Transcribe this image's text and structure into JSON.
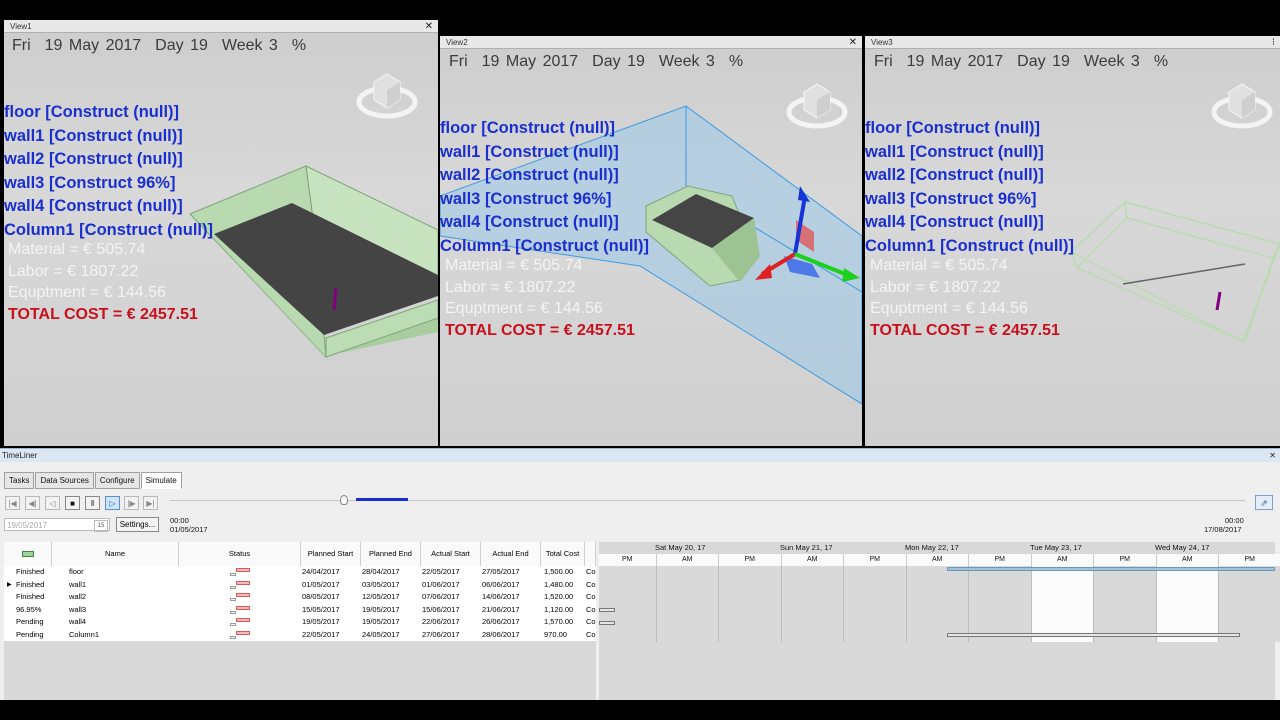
{
  "views": [
    {
      "title": "View1",
      "header": {
        "day_name": "Fri",
        "date": "19 May 2017",
        "day": "Day 19",
        "week": "Week 3",
        "pct": "%"
      }
    },
    {
      "title": "View2",
      "header": {
        "day_name": "Fri",
        "date": "19 May 2017",
        "day": "Day 19",
        "week": "Week 3",
        "pct": "%"
      }
    },
    {
      "title": "View3",
      "header": {
        "day_name": "Fri",
        "date": "19 May 2017",
        "day": "Day 19",
        "week": "Week 3",
        "pct": "%"
      }
    }
  ],
  "elements": [
    "floor [Construct (null)]",
    "wall1 [Construct (null)]",
    "wall2 [Construct (null)]",
    "wall3 [Construct 96%]",
    "wall4 [Construct (null)]",
    "Column1 [Construct (null)]"
  ],
  "costs": {
    "material": "Material  = € 505.74",
    "labor": "Labor = € 1807.22",
    "equipment": "Equptment = € 144.56",
    "total": "TOTAL COST = €  2457.51"
  },
  "colors": {
    "element_text": "#1a2fcf",
    "total_text": "#c8101c",
    "cost_text": "#f4f4f4",
    "wall_green": "#b9d9b0",
    "floor_dark": "#444444",
    "selection_blue": "#8ec6ee"
  },
  "timeliner": {
    "title": "TimeLiner",
    "tabs": [
      "Tasks",
      "Data Sources",
      "Configure",
      "Simulate"
    ],
    "active_tab": "Simulate",
    "date_value": "19/05/2017",
    "settings_label": "Settings...",
    "start_time": "00:00",
    "start_date": "01/05/2017",
    "end_time": "00:00",
    "end_date": "17/08/2017",
    "slider_position_pct": 0.162,
    "columns": [
      "Name",
      "Status",
      "Planned Start",
      "Planned End",
      "Actual Start",
      "Actual End",
      "Total Cost"
    ],
    "rows": [
      {
        "state": "Finished",
        "name": "floor",
        "ps": "24/04/2017",
        "pe": "28/04/2017",
        "as": "22/05/2017",
        "ae": "27/05/2017",
        "cost": "1,500.00",
        "extra": "Co"
      },
      {
        "state": "Finished",
        "name": "wall1",
        "ps": "01/05/2017",
        "pe": "03/05/2017",
        "as": "01/06/2017",
        "ae": "06/06/2017",
        "cost": "1,480.00",
        "extra": "Co"
      },
      {
        "state": "Finished",
        "name": "wall2",
        "ps": "08/05/2017",
        "pe": "12/05/2017",
        "as": "07/06/2017",
        "ae": "14/06/2017",
        "cost": "1,520.00",
        "extra": "Co"
      },
      {
        "state": "96.95%",
        "name": "wall3",
        "ps": "15/05/2017",
        "pe": "19/05/2017",
        "as": "15/06/2017",
        "ae": "21/06/2017",
        "cost": "1,120.00",
        "extra": "Co"
      },
      {
        "state": "Pending",
        "name": "wall4",
        "ps": "19/05/2017",
        "pe": "19/05/2017",
        "as": "22/06/2017",
        "ae": "26/06/2017",
        "cost": "1,570.00",
        "extra": "Co"
      },
      {
        "state": "Pending",
        "name": "Column1",
        "ps": "22/05/2017",
        "pe": "24/05/2017",
        "as": "27/06/2017",
        "ae": "28/06/2017",
        "cost": "970.00",
        "extra": "Co"
      }
    ],
    "gantt_days": [
      "Sat May 20, 17",
      "Sun May 21, 17",
      "Mon May 22, 17",
      "Tue May 23, 17",
      "Wed May 24, 17"
    ],
    "gantt_halves": [
      "PM",
      "AM",
      "PM",
      "AM",
      "PM",
      "AM",
      "PM",
      "AM",
      "PM",
      "AM",
      "PM"
    ]
  }
}
